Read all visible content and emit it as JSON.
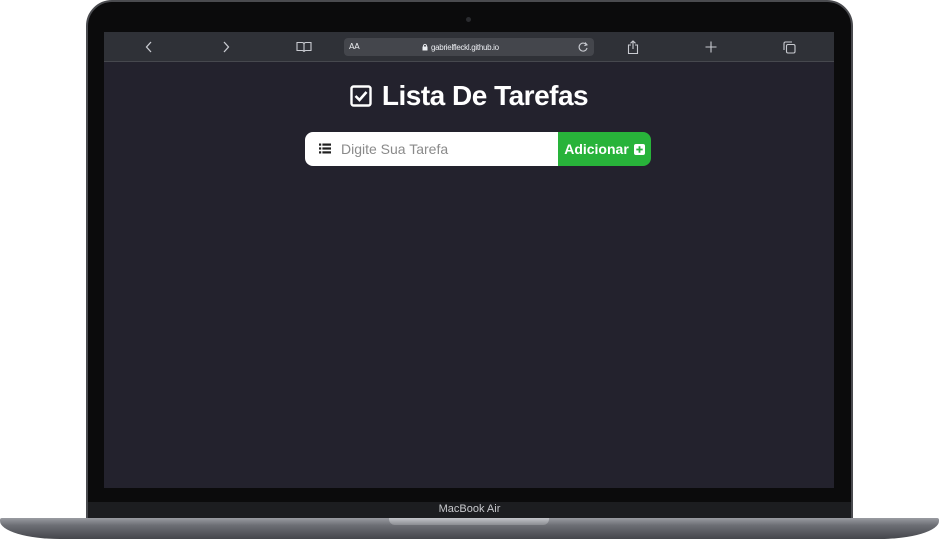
{
  "browser": {
    "reader_label": "AA",
    "url": "gabrielfleckl.github.io",
    "icons": {
      "back": "chevron-left-icon",
      "forward": "chevron-right-icon",
      "bookmarks": "book-icon",
      "lock": "lock-icon",
      "reload": "reload-icon",
      "share": "share-icon",
      "new_tab": "plus-icon",
      "tabs": "tabs-icon"
    }
  },
  "app": {
    "title": "Lista De Tarefas",
    "title_icon": "checkbox-checked-icon",
    "input": {
      "placeholder": "Digite Sua Tarefa",
      "value": "",
      "icon": "list-icon"
    },
    "add_button": {
      "label": "Adicionar",
      "icon": "plus-square-icon",
      "color": "#28b33a"
    },
    "background_color": "#23222d"
  },
  "device": {
    "model_label": "MacBook Air"
  }
}
